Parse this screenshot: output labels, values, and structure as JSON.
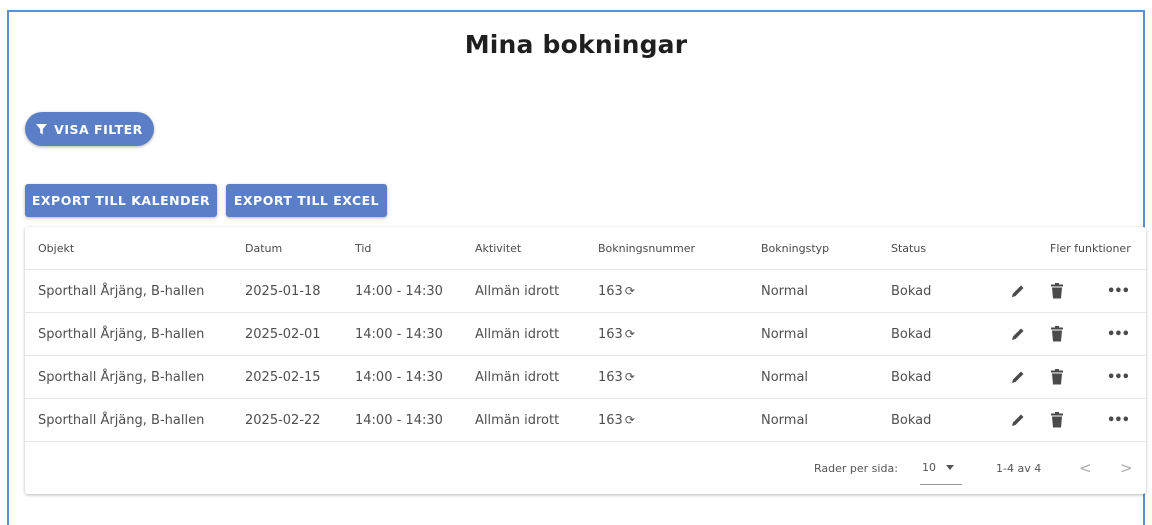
{
  "page": {
    "title": "Mina bokningar"
  },
  "toolbar": {
    "filter_label": "VISA FILTER",
    "export_calendar_label": "EXPORT TILL KALENDER",
    "export_excel_label": "EXPORT TILL EXCEL"
  },
  "table": {
    "headers": [
      "Objekt",
      "Datum",
      "Tid",
      "Aktivitet",
      "Bokningsnummer",
      "Bokningstyp",
      "Status",
      "Fler funktioner"
    ],
    "rows": [
      {
        "objekt": "Sporthall Årjäng, B-hallen",
        "datum": "2025-01-18",
        "tid": "14:00 - 14:30",
        "aktivitet": "Allmän idrott",
        "bokningsnummer": "163",
        "bokningstyp": "Normal",
        "status": "Bokad"
      },
      {
        "objekt": "Sporthall Årjäng, B-hallen",
        "datum": "2025-02-01",
        "tid": "14:00 - 14:30",
        "aktivitet": "Allmän idrott",
        "bokningsnummer": "163",
        "bokningstyp": "Normal",
        "status": "Bokad"
      },
      {
        "objekt": "Sporthall Årjäng, B-hallen",
        "datum": "2025-02-15",
        "tid": "14:00 - 14:30",
        "aktivitet": "Allmän idrott",
        "bokningsnummer": "163",
        "bokningstyp": "Normal",
        "status": "Bokad"
      },
      {
        "objekt": "Sporthall Årjäng, B-hallen",
        "datum": "2025-02-22",
        "tid": "14:00 - 14:30",
        "aktivitet": "Allmän idrott",
        "bokningsnummer": "163",
        "bokningstyp": "Normal",
        "status": "Bokad"
      }
    ],
    "icons": {
      "recurring": "refresh-icon",
      "edit": "pencil-icon",
      "delete": "trash-icon",
      "more": "more-horizontal-icon"
    }
  },
  "pagination": {
    "rows_per_page_label": "Rader per sida:",
    "rows_per_page_value": "10",
    "range_label": "1-4 av 4"
  },
  "colors": {
    "accent": "#5b7fc6",
    "frame": "#5b8fd0"
  }
}
